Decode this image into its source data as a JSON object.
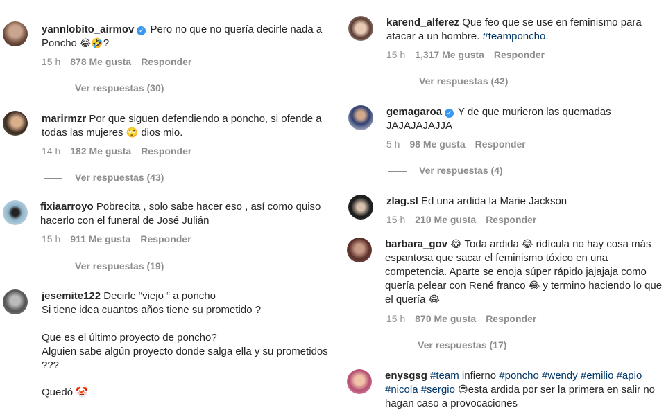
{
  "left": [
    {
      "user": "yannlobito_airmov",
      "verified": true,
      "text": " Pero no que no quería decirle nada a Poncho ",
      "emoji": "😂🤣",
      "tail": "?",
      "time": "15 h",
      "likes": "878 Me gusta",
      "reply": "Responder",
      "replies": "Ver respuestas (30)"
    },
    {
      "user": "marirmzr",
      "text": " Por que siguen defendiendo a poncho, si ofende a todas las mujeres ",
      "emoji": "🙄",
      "tail": " dios mio.",
      "time": "14 h",
      "likes": "182 Me gusta",
      "reply": "Responder",
      "replies": "Ver respuestas (43)"
    },
    {
      "user": "fixiaarroyo",
      "text": " Pobrecita , solo sabe hacer eso , así como quiso hacerlo con el funeral de José Julián",
      "time": "15 h",
      "likes": "911 Me gusta",
      "reply": "Responder",
      "replies": "Ver respuestas (19)"
    },
    {
      "user": "jesemite122",
      "line1": " Decirle “viejo “ a poncho",
      "line2": "Si tiene idea cuantos años tiene su prometido ?",
      "line3": "Que es el último proyecto de poncho?",
      "line4": "Alguien sabe algún proyecto donde salga ella y su prometidos ???",
      "line5": "Quedó ",
      "emoji": "🤡"
    }
  ],
  "right": [
    {
      "user": "karend_alferez",
      "text": " Que feo que se use en feminismo para atacar a un hombre. ",
      "tag": "#teamponcho",
      "tail": ".",
      "time": "15 h",
      "likes": "1,317 Me gusta",
      "reply": "Responder",
      "replies": "Ver respuestas (42)"
    },
    {
      "user": "gemagaroa",
      "verified": true,
      "text": " Y de que murieron las quemadas JAJAJAJAJJA",
      "time": "5 h",
      "likes": "98 Me gusta",
      "reply": "Responder",
      "replies": "Ver respuestas (4)"
    },
    {
      "user": "zlag.sl",
      "text": " Ed una ardida la Marie Jackson",
      "time": "15 h",
      "likes": "210 Me gusta",
      "reply": "Responder"
    },
    {
      "user": "barbara_gov",
      "l1": " Toda ardida ",
      "l1b": " ridícula no hay cosa más",
      "l2": "espantosa que sacar el feminismo tóxico en una",
      "l3": "competencia. Aparte se enoja súper rápido jajajaja como",
      "l4a": "quería pelear con René franco ",
      "l4b": " y termino haciendo lo que",
      "l5": "el quería ",
      "emoji": "😂",
      "time": "15 h",
      "likes": "870 Me gusta",
      "reply": "Responder",
      "replies": "Ver respuestas (17)"
    },
    {
      "user": "enysgsg",
      "t1": "#team",
      "t2": " infierno ",
      "t3": "#poncho",
      "t4": "#wendy",
      "t5": "#emilio",
      "t6": "#apio",
      "t7": "#nicola",
      "t8": "#sergio",
      "emoji": "😍",
      "t9": "esta ardida por ser la primera en salir no",
      "t10": "hagan caso a provocaciones"
    }
  ],
  "colors": {
    "link": "#00376b",
    "meta": "#8e8e8e",
    "verified": "#3897f0"
  }
}
